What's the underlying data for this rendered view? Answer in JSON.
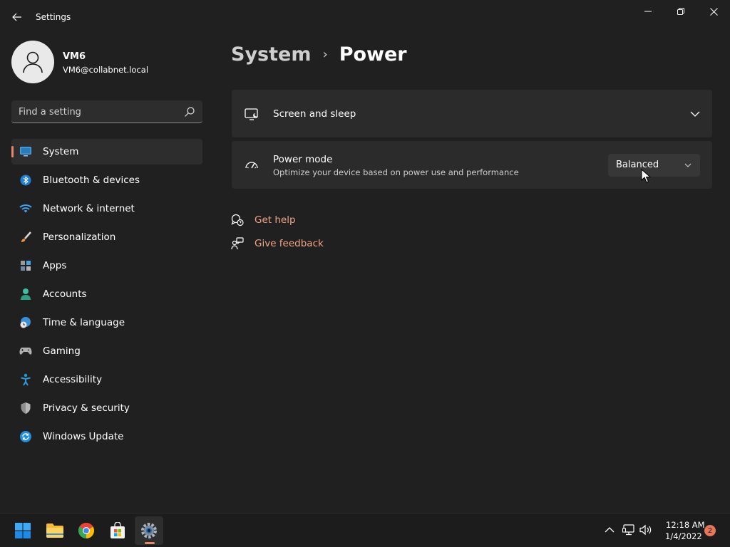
{
  "window": {
    "title": "Settings",
    "controls": [
      "minimize",
      "maximize",
      "close"
    ]
  },
  "profile": {
    "name": "VM6",
    "email": "VM6@collabnet.local"
  },
  "search": {
    "placeholder": "Find a setting",
    "value": ""
  },
  "sidebar": {
    "items": [
      {
        "label": "System",
        "icon": "monitor-icon",
        "selected": true
      },
      {
        "label": "Bluetooth & devices",
        "icon": "bluetooth-icon"
      },
      {
        "label": "Network & internet",
        "icon": "wifi-icon"
      },
      {
        "label": "Personalization",
        "icon": "brush-icon"
      },
      {
        "label": "Apps",
        "icon": "apps-icon"
      },
      {
        "label": "Accounts",
        "icon": "person-icon"
      },
      {
        "label": "Time & language",
        "icon": "globe-clock-icon"
      },
      {
        "label": "Gaming",
        "icon": "gamepad-icon"
      },
      {
        "label": "Accessibility",
        "icon": "accessibility-icon"
      },
      {
        "label": "Privacy & security",
        "icon": "shield-icon"
      },
      {
        "label": "Windows Update",
        "icon": "update-icon"
      }
    ]
  },
  "breadcrumb": {
    "parent": "System",
    "separator": "›",
    "current": "Power"
  },
  "cards": {
    "screen_sleep": {
      "title": "Screen and sleep",
      "icon": "screen-sleep-icon"
    },
    "power_mode": {
      "title": "Power mode",
      "description": "Optimize your device based on power use and performance",
      "selected": "Balanced",
      "icon": "gauge-icon"
    }
  },
  "links": {
    "get_help": "Get help",
    "give_feedback": "Give feedback"
  },
  "taskbar": {
    "apps": [
      "start-icon",
      "file-explorer-icon",
      "chrome-icon",
      "store-icon",
      "settings-icon"
    ],
    "active_app": "settings-icon",
    "clock_time": "12:18 AM",
    "clock_date": "1/4/2022",
    "notification_count": "2"
  },
  "colors": {
    "background": "#202020",
    "card": "#2b2b2b",
    "accent": "#e8876b",
    "link": "#f0a487"
  }
}
